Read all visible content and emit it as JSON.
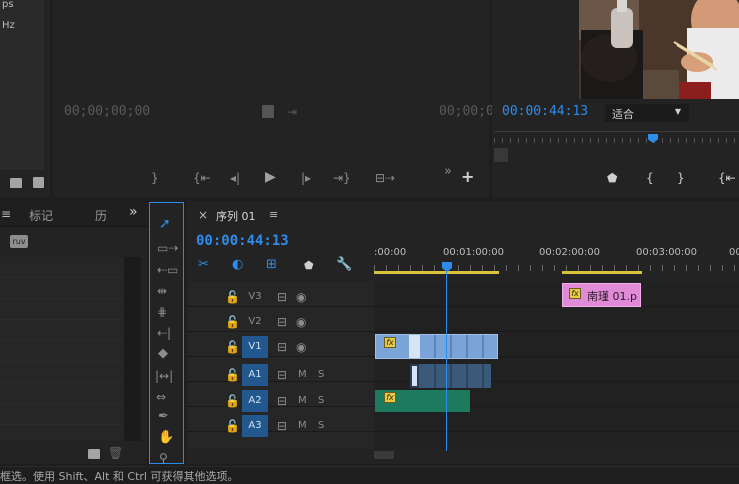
{
  "project_panel": {
    "truncated_top1": "ps",
    "truncated_top2": "Hz",
    "tab_menu": "≡",
    "tab_markers": "标记",
    "tab_history": "历",
    "more": "»",
    "file_badge": "ruv"
  },
  "source_monitor": {
    "timecode_in": "00;00;00;00",
    "timecode_out": "00;00;0",
    "more": "»",
    "add": "+"
  },
  "program_monitor": {
    "timecode": "00:00:44:13",
    "zoom_value": "适合"
  },
  "timeline": {
    "close": "×",
    "sequence_name": "序列 01",
    "menu": "≡",
    "timecode": "00:00:44:13",
    "ruler_labels": [
      ":00:00",
      "00:01:00:00",
      "00:02:00:00",
      "00:03:00:00",
      "00"
    ],
    "playhead_fraction": 0.204,
    "tracks": [
      {
        "label": "V3",
        "mute": "",
        "solo": ""
      },
      {
        "label": "V2",
        "mute": "",
        "solo": ""
      },
      {
        "label": "V1",
        "mute": "",
        "solo": ""
      },
      {
        "label": "A1",
        "mute": "M",
        "solo": "S"
      },
      {
        "label": "A2",
        "mute": "M",
        "solo": "S"
      },
      {
        "label": "A3",
        "mute": "M",
        "solo": "S"
      }
    ],
    "image_clip_label": "南瑾 01.p",
    "fx_badge": "fx"
  },
  "status_bar": {
    "text": "框选。使用 Shift、Alt 和 Ctrl 可获得其他选项。"
  },
  "colors": {
    "accent_blue": "#2d8ceb",
    "clip_video": "#7aa3d8",
    "clip_audio": "#1e7a5e",
    "clip_image": "#e08ad8",
    "work_area": "#d9c33b"
  }
}
